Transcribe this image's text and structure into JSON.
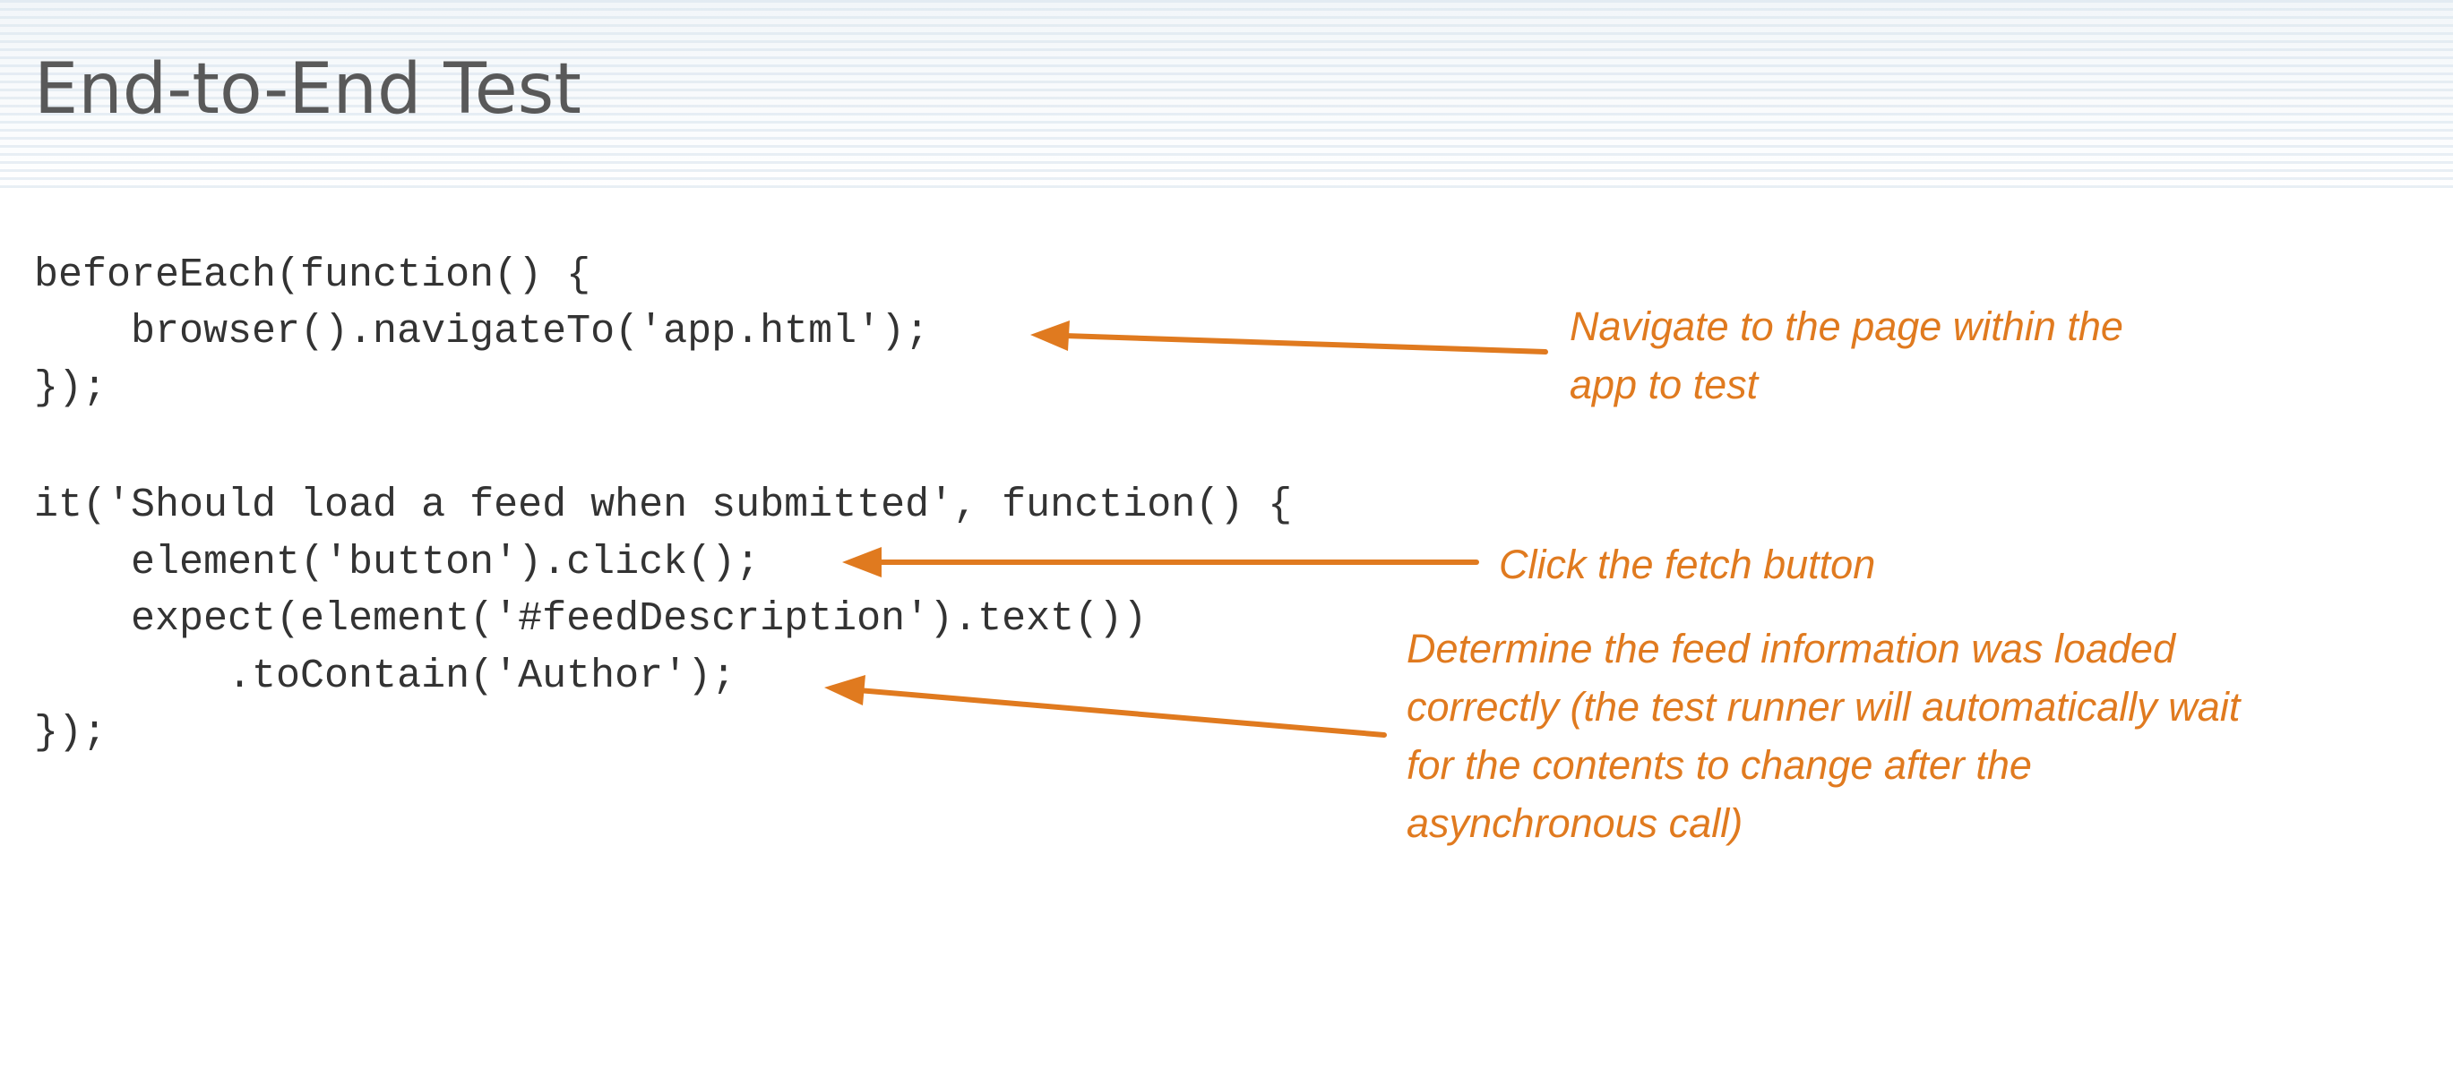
{
  "slide": {
    "title": "End-to-End Test"
  },
  "code": {
    "lines": [
      "beforeEach(function() {",
      "    browser().navigateTo('app.html');",
      "});",
      "it('Should load a feed when submitted', function() {",
      "    element('button').click();",
      "    expect(element('#feedDescription').text())",
      "        .toContain('Author');",
      "});"
    ]
  },
  "annotations": {
    "navigate": {
      "lines": [
        "Navigate to the page within the",
        "app to test"
      ]
    },
    "click": {
      "lines": [
        "Click the fetch button"
      ]
    },
    "determine": {
      "lines": [
        "Determine the feed information was loaded",
        "correctly (the test runner will automatically wait",
        "for the contents to change after the",
        "asynchronous call)"
      ]
    }
  },
  "colors": {
    "accent": "#e07a1f",
    "title": "#595959",
    "code": "#333333"
  },
  "icons": [
    "arrow-left-icon"
  ]
}
